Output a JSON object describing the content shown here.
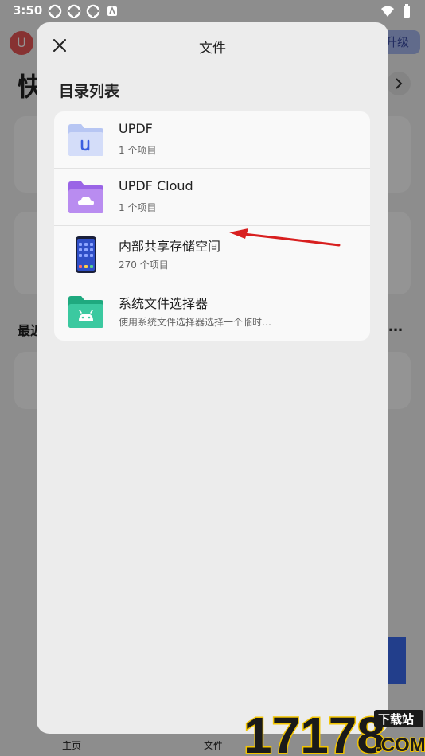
{
  "status_bar": {
    "time": "3:50"
  },
  "background": {
    "avatar_letter": "U",
    "upgrade_label": "升级",
    "title_fragment": "快",
    "recent_fragment": "最近",
    "more_label": "…",
    "nav": {
      "home": "主页",
      "files": "文件"
    }
  },
  "sheet": {
    "title": "文件",
    "section_title": "目录列表",
    "items": [
      {
        "name": "UPDF",
        "sub": "1 个项目",
        "icon": "updf-folder-icon"
      },
      {
        "name": "UPDF Cloud",
        "sub": "1 个项目",
        "icon": "cloud-folder-icon"
      },
      {
        "name": "内部共享存储空间",
        "sub": "270 个项目",
        "icon": "phone-icon"
      },
      {
        "name": "系统文件选择器",
        "sub": "使用系统文件选择器选择一个临时…",
        "icon": "android-folder-icon"
      }
    ]
  },
  "colors": {
    "updf_folder": "#c9d4f7",
    "cloud_folder": "#b98cf0",
    "android_folder": "#3bc9a0",
    "annotation_arrow": "#d81f1f"
  },
  "watermark": {
    "number": "17178",
    "tag": "下载站",
    "domain": ".COM"
  }
}
